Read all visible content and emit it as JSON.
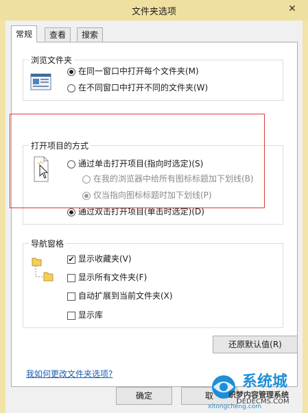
{
  "window": {
    "title": "文件夹选项",
    "close_glyph": "✕"
  },
  "tabs": [
    {
      "label": "常规"
    },
    {
      "label": "查看"
    },
    {
      "label": "搜索"
    }
  ],
  "browse_folders": {
    "title": "浏览文件夹",
    "options": [
      {
        "label": "在同一窗口中打开每个文件夹(M)",
        "selected": true
      },
      {
        "label": "在不同窗口中打开不同的文件夹(W)",
        "selected": false
      }
    ]
  },
  "open_items": {
    "title": "打开项目的方式",
    "single_click": {
      "label": "通过单击打开项目(指向时选定)(S)",
      "selected": false
    },
    "sub_options": [
      {
        "label": "在我的浏览器中给所有图标标题加下划线(B)",
        "selected": false
      },
      {
        "label": "仅当指向图标标题时加下划线(P)",
        "selected": true
      }
    ],
    "double_click": {
      "label": "通过双击打开项目(单击时选定)(D)",
      "selected": true
    }
  },
  "nav_pane": {
    "title": "导航窗格",
    "options": [
      {
        "label": "显示收藏夹(V)",
        "checked": true
      },
      {
        "label": "显示所有文件夹(F)",
        "checked": false
      },
      {
        "label": "自动扩展到当前文件夹(X)",
        "checked": false
      },
      {
        "label": "显示库",
        "checked": false
      }
    ]
  },
  "restore_button": "还原默认值(R)",
  "help_link": "我如何更改文件夹选项?",
  "footer": {
    "ok": "确定",
    "cancel": "取"
  },
  "watermark": {
    "line1": "系统城",
    "line2": "织梦内容管理系统",
    "line3": "DEDECMS.COM",
    "line4": "xitongcheng.com"
  }
}
